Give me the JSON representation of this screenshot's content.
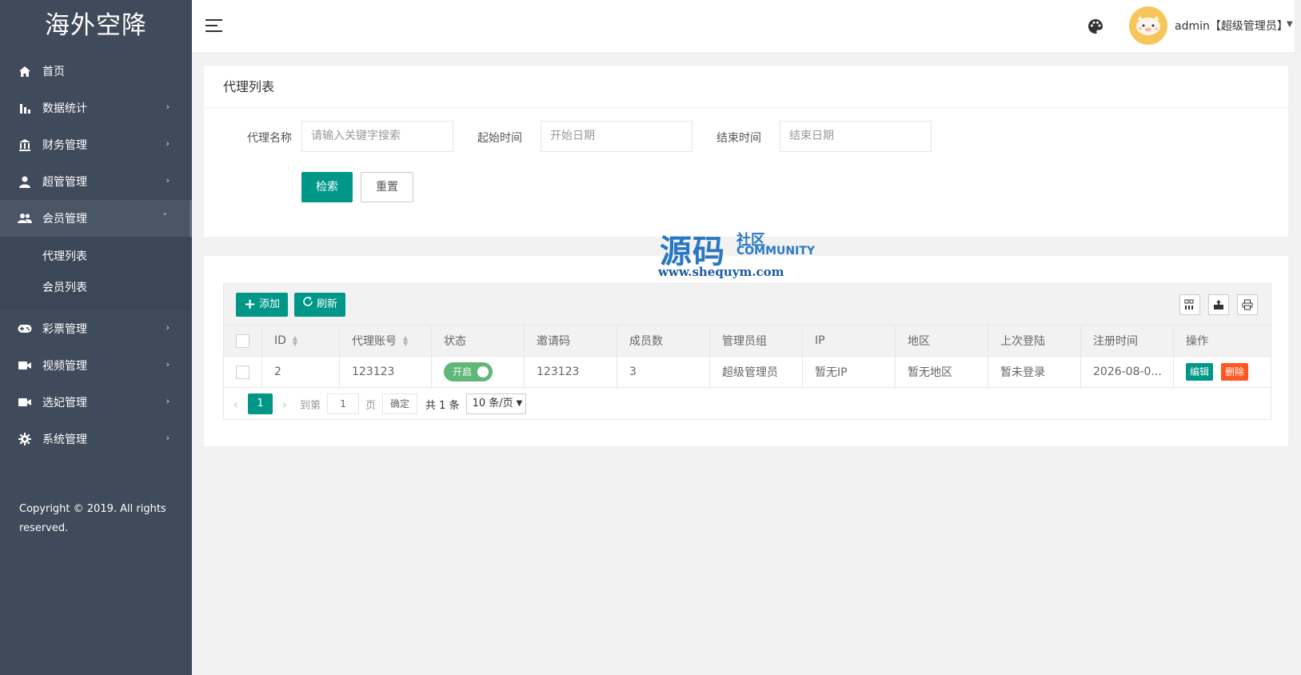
{
  "sidebar": {
    "brand": "海外空降",
    "items": [
      {
        "label": "首页",
        "icon": "home-icon"
      },
      {
        "label": "数据统计",
        "icon": "bar-chart-icon"
      },
      {
        "label": "财务管理",
        "icon": "bank-icon"
      },
      {
        "label": "超管管理",
        "icon": "user-icon"
      },
      {
        "label": "会员管理",
        "icon": "users-icon"
      },
      {
        "label": "彩票管理",
        "icon": "gamepad-icon"
      },
      {
        "label": "视频管理",
        "icon": "video-icon"
      },
      {
        "label": "选妃管理",
        "icon": "video-icon"
      },
      {
        "label": "系统管理",
        "icon": "gear-icon"
      }
    ],
    "submenu": [
      "代理列表",
      "会员列表"
    ],
    "copyright": "Copyright © 2019. All rights reserved."
  },
  "header": {
    "user": "admin【超级管理员】"
  },
  "search_card": {
    "title": "代理列表",
    "fields": [
      {
        "label": "代理名称",
        "placeholder": "请输入关键字搜索"
      },
      {
        "label": "起始时间",
        "placeholder": "开始日期"
      },
      {
        "label": "结束时间",
        "placeholder": "结束日期"
      }
    ],
    "search_button": "检索",
    "reset_button": "重置"
  },
  "toolbar": {
    "add_label": "添加",
    "refresh_label": "刷新"
  },
  "table": {
    "columns": [
      "ID",
      "代理账号",
      "状态",
      "邀请码",
      "成员数",
      "管理员组",
      "IP",
      "地区",
      "上次登陆",
      "注册时间",
      "操作"
    ],
    "rows": [
      {
        "id": "2",
        "account": "123123",
        "status": "开启",
        "invite_code": "123123",
        "members": "3",
        "group": "超级管理员",
        "ip": "暂无IP",
        "region": "暂无地区",
        "last_login": "暂未登录",
        "registered": "2026-08-0...",
        "edit": "编辑",
        "delete": "删除"
      }
    ]
  },
  "pager": {
    "current": "1",
    "goto_prefix": "到第",
    "goto_value": "1",
    "goto_suffix": "页",
    "confirm": "确定",
    "total": "共 1 条",
    "page_size": "10 条/页"
  },
  "watermark": {
    "main": "源码",
    "sub1": "社区",
    "sub2": "COMMUNITY",
    "url": "www.shequym.com"
  },
  "colors": {
    "sidebar": "#3f4a5a",
    "primary": "#009688",
    "switch_on": "#5fb878",
    "danger": "#ff5722"
  }
}
